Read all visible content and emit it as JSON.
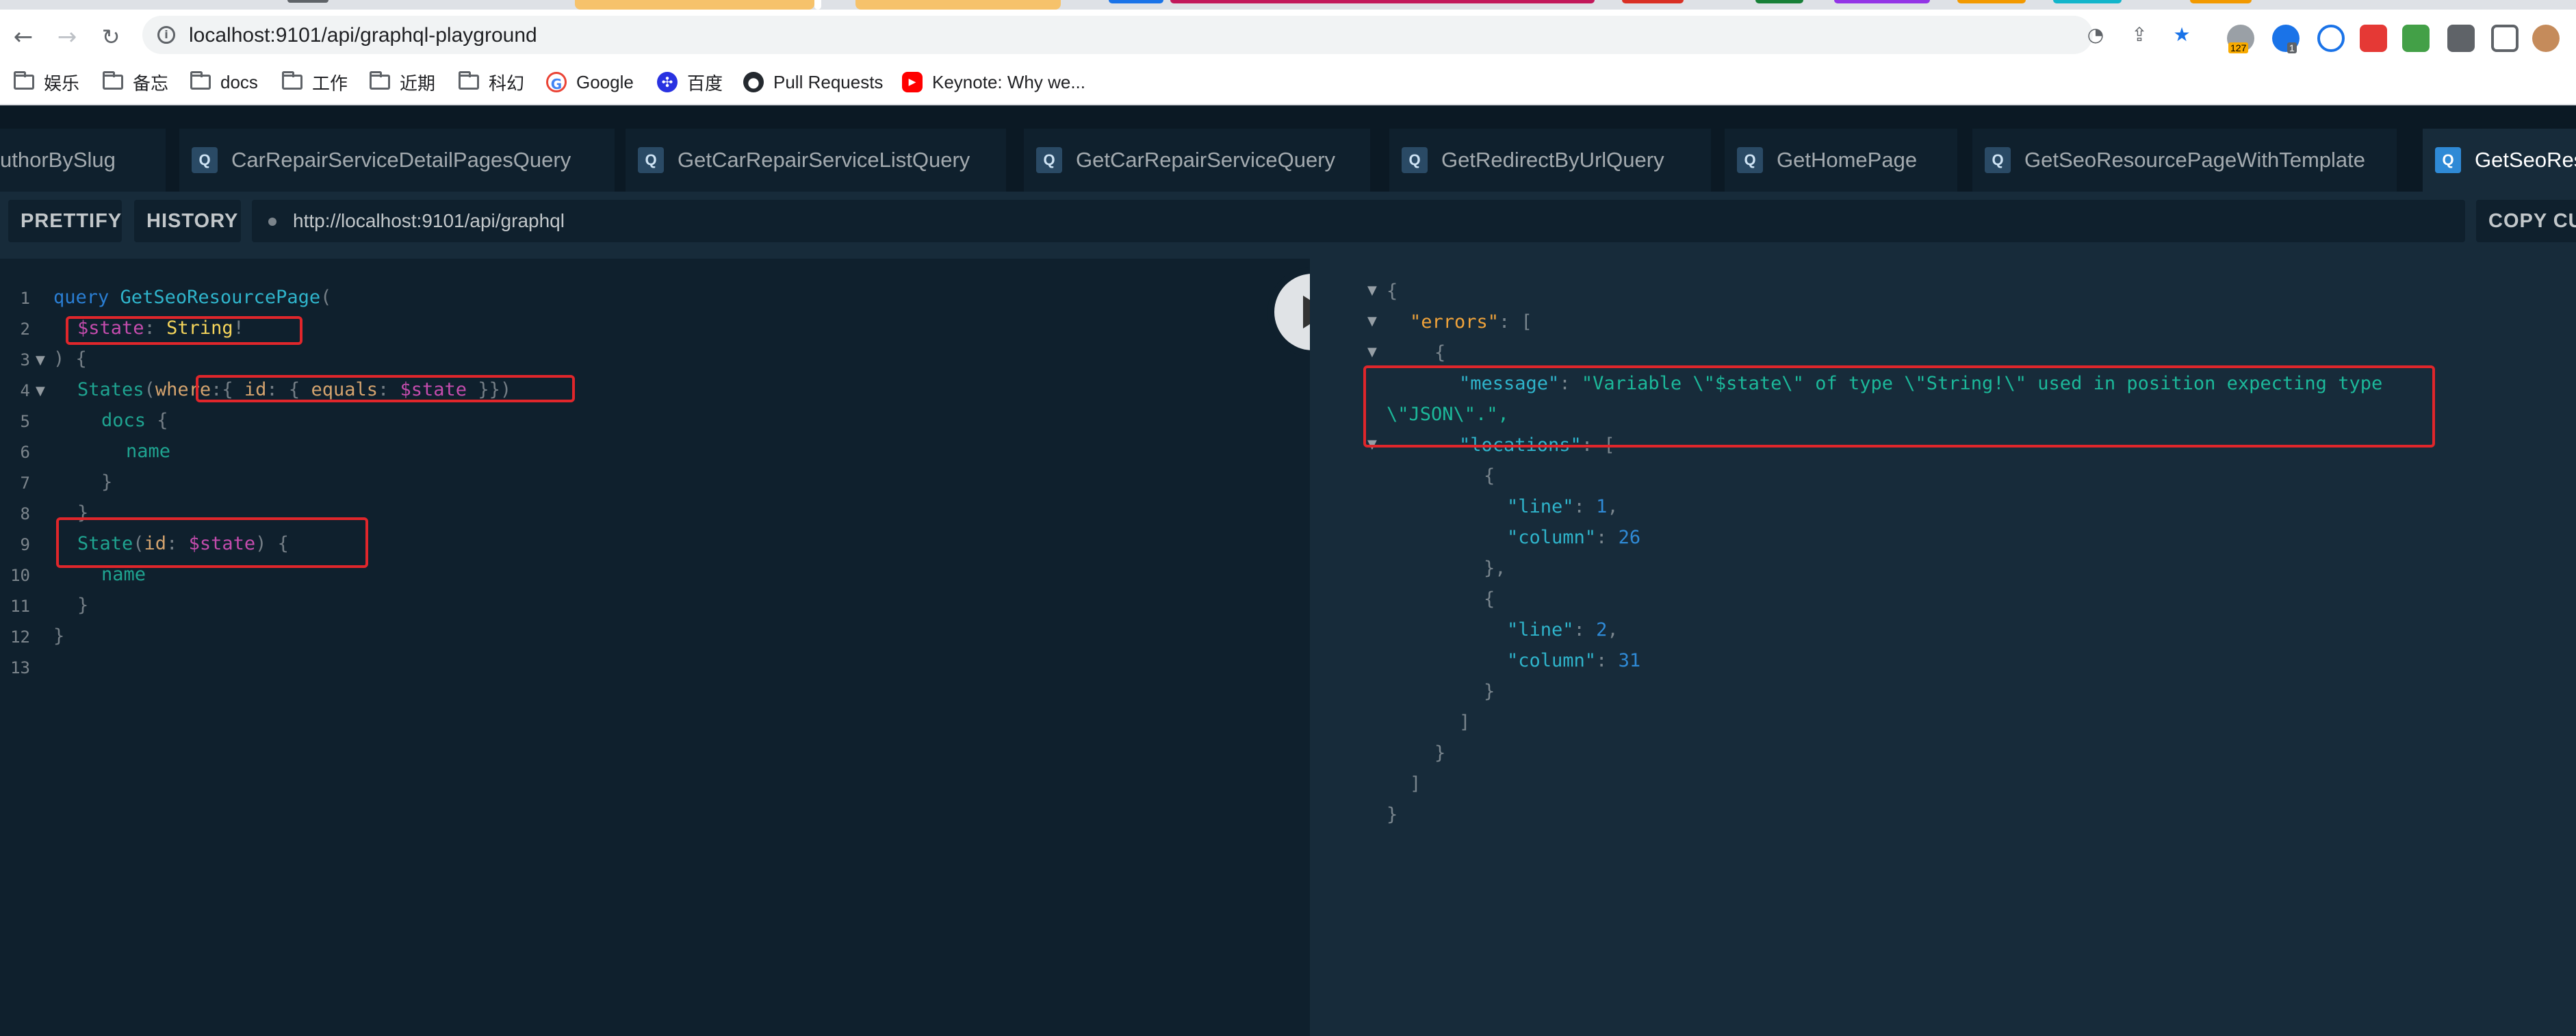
{
  "browser": {
    "url": "localhost:9101/api/graphql-playground",
    "extension_badge": "127",
    "extension_badge_2": "1"
  },
  "bookmarks": [
    {
      "label": "娱乐",
      "icon": "folder-icon"
    },
    {
      "label": "备忘",
      "icon": "folder-icon"
    },
    {
      "label": "docs",
      "icon": "folder-icon"
    },
    {
      "label": "工作",
      "icon": "folder-icon"
    },
    {
      "label": "近期",
      "icon": "folder-icon"
    },
    {
      "label": "科幻",
      "icon": "folder-icon"
    },
    {
      "label": "Google",
      "icon": "google-icon"
    },
    {
      "label": "百度",
      "icon": "baidu-icon"
    },
    {
      "label": "Pull Requests",
      "icon": "github-icon"
    },
    {
      "label": "Keynote: Why we...",
      "icon": "youtube-icon"
    }
  ],
  "playground": {
    "tabs": [
      {
        "label": "uthorBySlug"
      },
      {
        "label": "CarRepairServiceDetailPagesQuery",
        "badge": "Q"
      },
      {
        "label": "GetCarRepairServiceListQuery",
        "badge": "Q"
      },
      {
        "label": "GetCarRepairServiceQuery",
        "badge": "Q"
      },
      {
        "label": "GetRedirectByUrlQuery",
        "badge": "Q"
      },
      {
        "label": "GetHomePage",
        "badge": "Q"
      },
      {
        "label": "GetSeoResourcePageWithTemplate",
        "badge": "Q"
      },
      {
        "label": "GetSeoRes",
        "badge": "Q"
      }
    ],
    "toolbar": {
      "prettify": "PRETTIFY",
      "history": "HISTORY",
      "endpoint": "http://localhost:9101/api/graphql",
      "copy": "COPY CU"
    }
  },
  "editor": {
    "line_numbers": [
      "1",
      "2",
      "3",
      "4",
      "5",
      "6",
      "7",
      "8",
      "9",
      "10",
      "11",
      "12",
      "13"
    ],
    "query_keyword": "query",
    "operation_name": "GetSeoResourcePage",
    "var_name": "$state",
    "var_type": "String",
    "field_states": "States",
    "arg_where": "where",
    "arg_id": "id",
    "arg_equals": "equals",
    "field_docs": "docs",
    "field_name": "name",
    "field_state": "State",
    "p_open_paren": "(",
    "p_colon": ":",
    "p_bang": "!",
    "p_close_paren_brace": ") {",
    "p_brace_open": "{",
    "p_brace_close": "}",
    "p_close_args": "}})",
    "p_colon_brace": ": {"
  },
  "response": {
    "key_errors": "\"errors\"",
    "key_message": "\"message\"",
    "message_value": "\"Variable \\\"$state\\\" of type \\\"String!\\\" used in position expecting type",
    "message_value_cont": "\\\"JSON\\\".\",",
    "key_locations": "\"locations\"",
    "key_line": "\"line\"",
    "key_column": "\"column\"",
    "loc1_line": "1",
    "loc1_column": "26",
    "loc2_line": "2",
    "loc2_column": "31",
    "p_open_brace": "{",
    "p_close_brace": "}",
    "p_close_brace_comma": "},",
    "p_colon_bracket": ": [",
    "p_colon": ": ",
    "p_comma": ",",
    "p_close_bracket": "]"
  }
}
